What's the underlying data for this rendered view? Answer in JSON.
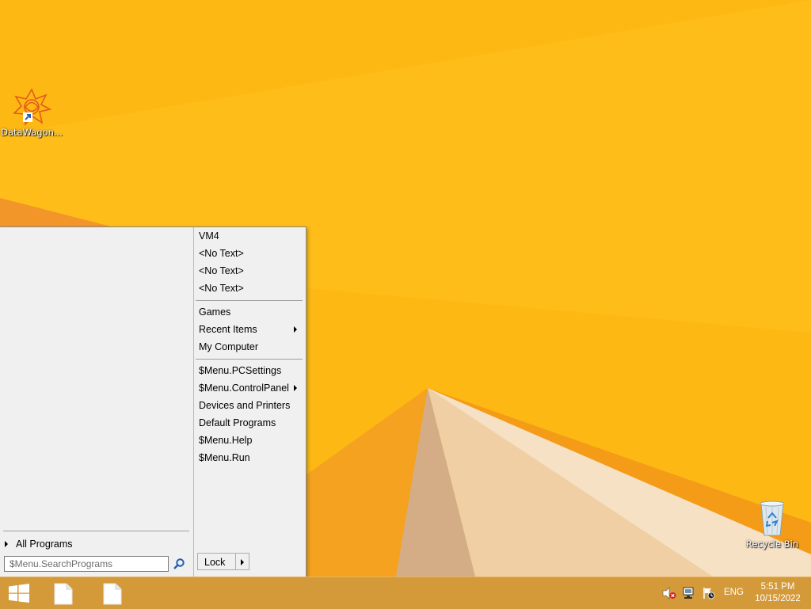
{
  "desktop": {
    "background_color": "#fdb813",
    "icons": [
      {
        "label": "DataWagon...",
        "icon": "datawagon-star-icon"
      },
      {
        "label": "Recycle Bin",
        "icon": "recycle-bin-icon"
      }
    ]
  },
  "start_menu": {
    "all_programs_label": "All Programs",
    "search_placeholder": "$Menu.SearchPrograms",
    "items": [
      {
        "label": "VM4",
        "submenu": false
      },
      {
        "label": "<No Text>",
        "submenu": false
      },
      {
        "label": "<No Text>",
        "submenu": false
      },
      {
        "label": "<No Text>",
        "submenu": false
      },
      {
        "label": "Games",
        "submenu": false
      },
      {
        "label": "Recent Items",
        "submenu": true
      },
      {
        "label": "My Computer",
        "submenu": false
      },
      {
        "label": "$Menu.PCSettings",
        "submenu": false
      },
      {
        "label": "$Menu.ControlPanel",
        "submenu": true
      },
      {
        "label": "Devices and Printers",
        "submenu": false
      },
      {
        "label": "Default Programs",
        "submenu": false
      },
      {
        "label": "$Menu.Help",
        "submenu": false
      },
      {
        "label": "$Menu.Run",
        "submenu": false
      }
    ],
    "shutdown_label": "Lock"
  },
  "taskbar": {
    "color": "#d49a3a",
    "tray": {
      "language": "ENG",
      "time": "5:51 PM",
      "date": "10/15/2022"
    }
  }
}
